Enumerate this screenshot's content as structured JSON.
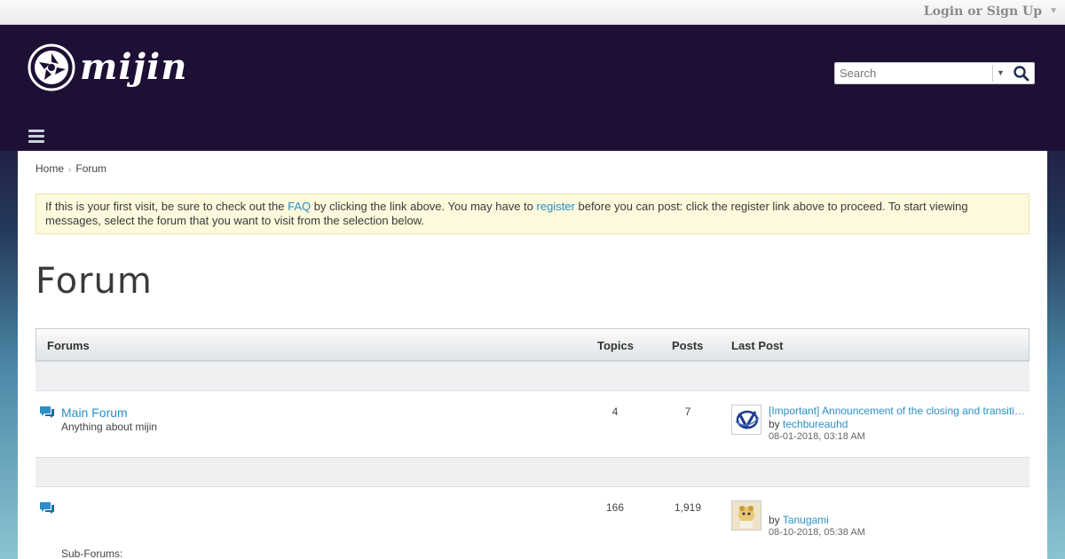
{
  "topbar": {
    "login_label": "Login or Sign Up"
  },
  "header": {
    "logo_text": "mijin",
    "search": {
      "placeholder": "Search"
    }
  },
  "breadcrumb": {
    "home": "Home",
    "current": "Forum"
  },
  "notice": {
    "part1": "If this is your first visit, be sure to check out the ",
    "faq": "FAQ",
    "part2": " by clicking the link above. You may have to ",
    "register": "register",
    "part3": " before you can post: click the register link above to proceed. To start viewing messages, select the forum that you want to visit from the selection below."
  },
  "page_title": "Forum",
  "table": {
    "headers": {
      "forums": "Forums",
      "topics": "Topics",
      "posts": "Posts",
      "last_post": "Last Post"
    },
    "rows": [
      {
        "title": "Main Forum",
        "description": "Anything about mijin",
        "topics": "4",
        "posts": "7",
        "last_post": {
          "title": "[Important] Announcement of the closing and transition of mijin forum",
          "by": "by ",
          "author": "techbureauhd",
          "date": "08-01-2018, 03:18 AM"
        }
      },
      {
        "title": "",
        "description": "",
        "topics": "166",
        "posts": "1,919",
        "subforums_label": "Sub-Forums:",
        "last_post": {
          "title": "",
          "by": "by ",
          "author": "Tanugami",
          "date": "08-10-2018, 05:38 AM"
        }
      }
    ]
  },
  "colors": {
    "link": "#2a8fc6",
    "header_bg": "#1e1035",
    "notice_bg": "#fdf9dd"
  }
}
